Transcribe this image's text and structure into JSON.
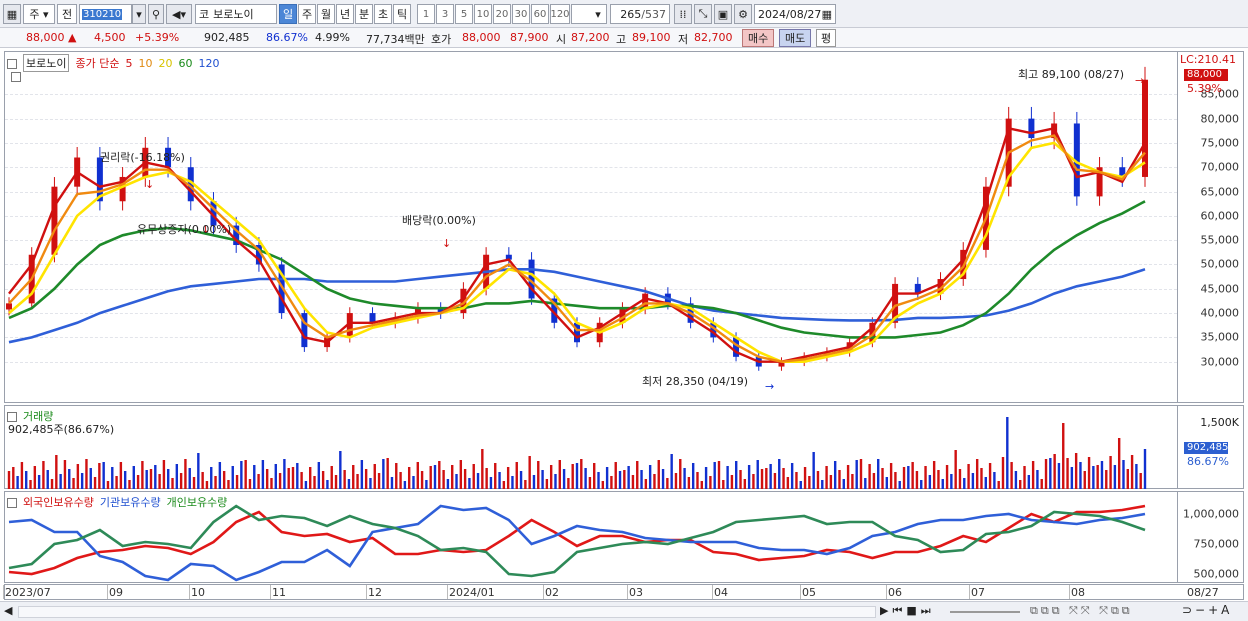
{
  "toolbar": {
    "market": "주",
    "prev_label": "전",
    "code": "310210",
    "name_prefix": "코",
    "name": "보로노이",
    "periods": [
      "일",
      "주",
      "월",
      "년",
      "분",
      "초",
      "틱"
    ],
    "selected_period": "일",
    "minutes": [
      "1",
      "3",
      "5",
      "10",
      "20",
      "30",
      "60",
      "120"
    ],
    "count": "265",
    "total": "/537",
    "date": "2024/08/27"
  },
  "quote": {
    "price": "88,000",
    "change": "4,500",
    "change_pct": "+5.39%",
    "volume": "902,485",
    "vol_ratio": "86.67%",
    "turnover": "4.99%",
    "amount": "77,734백만",
    "bid_label": "호가",
    "ask": "88,000",
    "bid": "87,900",
    "open_label": "시",
    "open": "87,200",
    "high_label": "고",
    "high": "89,100",
    "low_label": "저",
    "low": "82,700",
    "buy_label": "매수",
    "sell_label": "매도",
    "eq_label": "평"
  },
  "price_panel": {
    "name": "보로노이",
    "ma_label": "종가 단순",
    "ma_periods": [
      "5",
      "10",
      "20",
      "60",
      "120"
    ],
    "lc_label": "LC:210.41",
    "current_tag": "88,000",
    "current_pct": "5.39%",
    "y_ticks": [
      "85,000",
      "80,000",
      "75,000",
      "70,000",
      "65,000",
      "60,000",
      "55,000",
      "50,000",
      "45,000",
      "40,000",
      "35,000",
      "30,000"
    ],
    "annotations": {
      "high": "최고 89,100 (08/27)",
      "low": "최저 28,350 (04/19)",
      "ex_right1": "권리락(-16.18%)",
      "ex_right2": "유무상증자(0.00%)",
      "dividend": "배당락(0.00%)"
    }
  },
  "volume_panel": {
    "title": "거래량",
    "value_text": "902,485주(86.67%)",
    "tick": "1,500K",
    "tag_value": "902,485",
    "tag_pct": "86.67%"
  },
  "holdings_panel": {
    "foreign": "외국인보유수량",
    "institution": "기관보유수량",
    "retail": "개인보유수량",
    "ticks": [
      "1,000,000",
      "750,000",
      "500,000"
    ]
  },
  "x_axis": [
    "2023/07",
    "09",
    "10",
    "11",
    "12",
    "2024/01",
    "02",
    "03",
    "04",
    "05",
    "06",
    "07",
    "08",
    "08/27"
  ],
  "chart_data": {
    "type": "candlestick",
    "x_start": "2023/07",
    "x_end": "08/27",
    "ylim": [
      25000,
      90000
    ],
    "series": [
      {
        "name": "종가",
        "values": [
          42000,
          52000,
          66000,
          72000,
          63000,
          68000,
          74000,
          70000,
          63000,
          58000,
          54000,
          50000,
          40000,
          33000,
          35000,
          40000,
          38000,
          39000,
          41000,
          40000,
          45000,
          52000,
          51000,
          43000,
          38000,
          34000,
          38000,
          41000,
          44000,
          42000,
          38000,
          35000,
          31000,
          29000,
          30000,
          31000,
          32000,
          34000,
          38000,
          46000,
          44000,
          47000,
          53000,
          66000,
          80000,
          76000,
          79000,
          64000,
          70000,
          68000,
          88000
        ]
      },
      {
        "name": "5",
        "values": [
          44000,
          50000,
          62000,
          69000,
          66000,
          67000,
          71000,
          70000,
          65000,
          60000,
          55000,
          51000,
          43000,
          35000,
          34000,
          38000,
          38000,
          39000,
          40000,
          40000,
          43000,
          50000,
          51000,
          45000,
          40000,
          35000,
          37000,
          40000,
          43000,
          42000,
          39000,
          36000,
          32000,
          30000,
          30000,
          31000,
          32000,
          33000,
          37000,
          44000,
          44000,
          46000,
          51000,
          63000,
          78000,
          77000,
          78000,
          68000,
          69000,
          67000,
          75000
        ]
      },
      {
        "name": "20",
        "values": [
          40000,
          44000,
          52000,
          60000,
          64000,
          66000,
          68000,
          69000,
          67000,
          63000,
          59000,
          55000,
          48000,
          41000,
          36000,
          35000,
          37000,
          38000,
          39000,
          40000,
          41000,
          45000,
          49000,
          48000,
          44000,
          38000,
          36000,
          38000,
          41000,
          42000,
          41000,
          38000,
          35000,
          32000,
          30000,
          30000,
          31000,
          32000,
          34000,
          39000,
          42000,
          44000,
          48000,
          56000,
          68000,
          74000,
          75000,
          71000,
          69000,
          68000,
          71000
        ]
      },
      {
        "name": "60",
        "values": [
          39000,
          41000,
          45000,
          50000,
          54000,
          56000,
          57000,
          57500,
          57000,
          56000,
          55000,
          53000,
          51000,
          48000,
          45000,
          43000,
          42000,
          41500,
          41000,
          41000,
          41000,
          42000,
          42000,
          42500,
          42000,
          41500,
          41000,
          41000,
          41000,
          41500,
          41500,
          41000,
          40000,
          38500,
          37000,
          36000,
          35500,
          35000,
          35000,
          35000,
          35500,
          36000,
          37500,
          40000,
          44000,
          49000,
          53000,
          56000,
          58500,
          60500,
          63000
        ]
      },
      {
        "name": "120",
        "values": [
          34000,
          35000,
          36500,
          38000,
          40000,
          41500,
          43000,
          44500,
          45500,
          46000,
          46500,
          47000,
          47000,
          47000,
          46500,
          46500,
          46500,
          46500,
          47000,
          47500,
          48000,
          48500,
          49000,
          49000,
          48500,
          47500,
          46500,
          45500,
          44500,
          43000,
          41500,
          40500,
          40000,
          39500,
          39000,
          38800,
          38600,
          38500,
          38500,
          38600,
          39000,
          39000,
          39200,
          39500,
          40500,
          42000,
          44000,
          45500,
          46500,
          47500,
          49000
        ]
      }
    ]
  }
}
